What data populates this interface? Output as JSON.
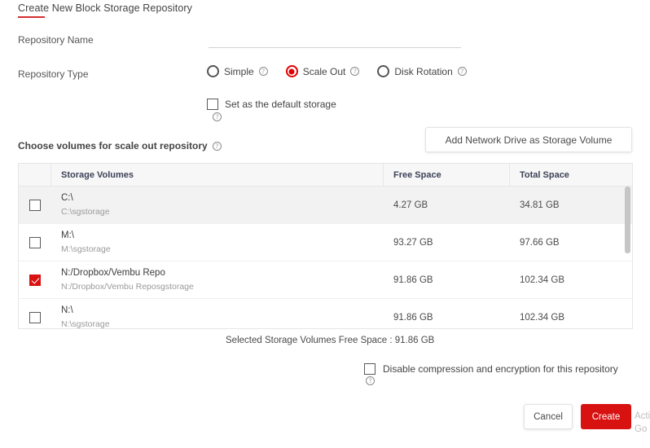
{
  "title": "Create New Block Storage Repository",
  "accent_color": "#d81111",
  "form": {
    "repository_name_label": "Repository Name",
    "repository_name_value": "",
    "repository_name_placeholder": "",
    "repository_type_label": "Repository Type",
    "repository_types": [
      {
        "label": "Simple",
        "selected": false,
        "help": "?"
      },
      {
        "label": "Scale Out",
        "selected": true,
        "help": "?"
      },
      {
        "label": "Disk Rotation",
        "selected": false,
        "help": "?"
      }
    ],
    "default_storage": {
      "label": "Set as the default storage",
      "checked": false,
      "help": "?"
    }
  },
  "volumes_section": {
    "heading": "Choose volumes for scale out repository",
    "heading_help": "?",
    "add_network_drive_label": "Add Network Drive as Storage Volume",
    "columns": [
      "",
      "Storage Volumes",
      "Free Space",
      "Total Space"
    ],
    "rows": [
      {
        "checked": false,
        "name": "C:\\",
        "path": "C:\\sgstorage",
        "free_space": "4.27 GB",
        "total_space": "34.81 GB"
      },
      {
        "checked": false,
        "name": "M:\\",
        "path": "M:\\sgstorage",
        "free_space": "93.27 GB",
        "total_space": "97.66 GB"
      },
      {
        "checked": true,
        "name": "N:/Dropbox/Vembu Repo",
        "path": "N:/Dropbox/Vembu Reposgstorage",
        "free_space": "91.86 GB",
        "total_space": "102.34 GB"
      },
      {
        "checked": false,
        "name": "N:\\",
        "path": "N:\\sgstorage",
        "free_space": "91.86 GB",
        "total_space": "102.34 GB"
      }
    ],
    "selected_summary": "Selected Storage Volumes Free Space : 91.86 GB"
  },
  "options": {
    "disable_compression": {
      "label": "Disable compression and encryption for this repository",
      "checked": false,
      "help": "?"
    }
  },
  "footer": {
    "cancel_label": "Cancel",
    "create_label": "Create"
  },
  "watermark": {
    "line1": "Activate Windows",
    "line2": "Go to Settings to activate Windows."
  }
}
